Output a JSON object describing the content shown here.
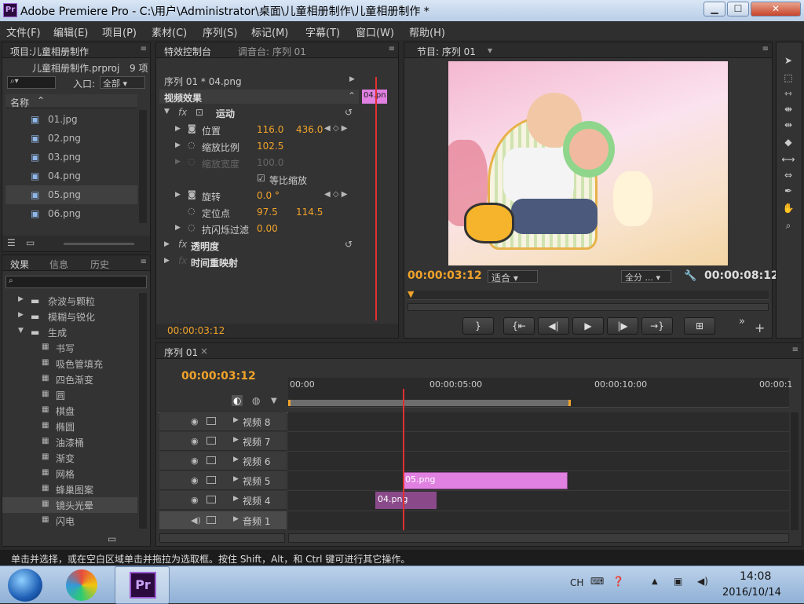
{
  "window": {
    "title": "Adobe Premiere Pro - C:\\用户\\Administrator\\桌面\\儿童相册制作\\儿童相册制作 *",
    "app_icon": "Pr",
    "min": "▁",
    "max": "☐",
    "close": "✕"
  },
  "menu": [
    "文件(F)",
    "编辑(E)",
    "项目(P)",
    "素材(C)",
    "序列(S)",
    "标记(M)",
    "字幕(T)",
    "窗口(W)",
    "帮助(H)"
  ],
  "project": {
    "tab": "项目:儿童相册制作",
    "file": "儿童相册制作.prproj",
    "count": "9 项",
    "entry_label": "入口:",
    "entry_value": "全部",
    "col_name": "名称",
    "items": [
      "01.jpg",
      "02.png",
      "03.png",
      "04.png",
      "05.png",
      "06.png"
    ]
  },
  "effects": {
    "tabs": [
      "效果",
      "信息",
      "历史"
    ],
    "items": [
      "杂波与颗粒",
      "模糊与锐化",
      "生成",
      "书写",
      "吸色管填充",
      "四色渐变",
      "圆",
      "棋盘",
      "椭圆",
      "油漆桶",
      "渐变",
      "网格",
      "蜂巢图案",
      "镜头光晕",
      "闪电"
    ]
  },
  "effect_controls": {
    "tabs": [
      "特效控制台",
      "调音台: 序列 01"
    ],
    "seq": "序列 01 * 04.png",
    "clip": "04.pn",
    "video_effects": "视频效果",
    "motion": "运动",
    "fx": "fx",
    "rows": [
      {
        "label": "位置",
        "v1": "116.0",
        "v2": "436.0"
      },
      {
        "label": "缩放比例",
        "v1": "102.5",
        "v2": ""
      },
      {
        "label": "缩放宽度",
        "v1": "100.0",
        "v2": ""
      },
      {
        "label": "等比缩放",
        "v1": "",
        "v2": ""
      },
      {
        "label": "旋转",
        "v1": "0.0 °",
        "v2": ""
      },
      {
        "label": "定位点",
        "v1": "97.5",
        "v2": "114.5"
      },
      {
        "label": "抗闪烁过滤",
        "v1": "0.00",
        "v2": ""
      }
    ],
    "opacity": "透明度",
    "time_remap": "时间重映射",
    "timecode": "00:00:03:12",
    "uniform_check": "☑"
  },
  "program": {
    "tab": "节目: 序列 01",
    "timecode": "00:00:03:12",
    "fit": "适合",
    "full": "全分 ...",
    "duration": "00:00:08:12",
    "controls": [
      "}",
      "{⇤",
      "◀|",
      "▶",
      "|▶",
      "→}",
      "⊞"
    ],
    "more": "»",
    "add": "+"
  },
  "timeline": {
    "tab": "序列 01",
    "timecode": "00:00:03:12",
    "ruler": [
      "00:00",
      "00:00:05:00",
      "00:00:10:00",
      "00:00:1"
    ],
    "tracks": [
      "视频 8",
      "视频 7",
      "视频 6",
      "视频 5",
      "视频 4",
      "音频 1"
    ],
    "clips": [
      {
        "name": "05.png",
        "track": "视频 5"
      },
      {
        "name": "04.png",
        "track": "视频 4"
      }
    ]
  },
  "status": "单击并选择，或在空白区域单击并拖拉为选取框。按住 Shift，Alt，和 Ctrl 键可进行其它操作。",
  "taskbar": {
    "lang": "CH",
    "time": "14:08",
    "date": "2016/10/14",
    "pr": "Pr"
  },
  "colors": {
    "accent": "#f0a32b",
    "clip_pink": "#e080e0",
    "clip_purple": "#8a4a8a",
    "playhead": "#e03030"
  }
}
